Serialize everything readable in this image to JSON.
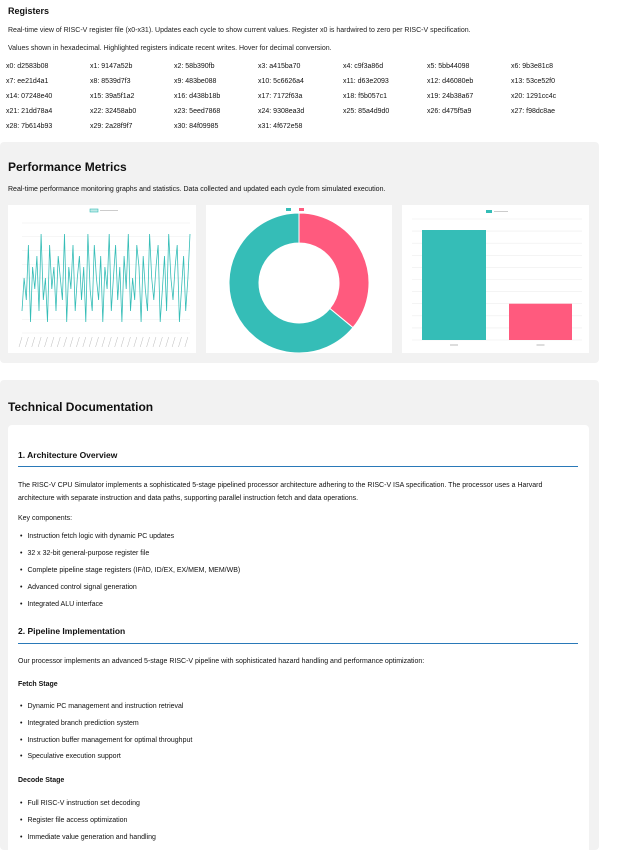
{
  "registers": {
    "title": "Registers",
    "desc1": "Real-time view of RISC-V register file (x0-x31). Updates each cycle to show current values. Register x0 is hardwired to zero per RISC-V specification.",
    "desc2": "Values shown in hexadecimal. Highlighted registers indicate recent writes. Hover for decimal conversion.",
    "items": [
      "x0: d2583b08",
      "x1: 9147a52b",
      "x2: 58b390fb",
      "x3: a415ba70",
      "x4: c9f3a86d",
      "x5: 5bb44098",
      "x6: 9b3e81c8",
      "x7: ee21d4a1",
      "x8: 8539d7f3",
      "x9: 483be088",
      "x10: 5c6626a4",
      "x11: d63e2093",
      "x12: d46080eb",
      "x13: 53ce52f0",
      "x14: 07248e40",
      "x15: 39a5f1a2",
      "x16: d438b18b",
      "x17: 7172f63a",
      "x18: f5b057c1",
      "x19: 24b38a67",
      "x20: 1291cc4c",
      "x21: 21dd78a4",
      "x22: 32458ab0",
      "x23: 5eed7868",
      "x24: 9308ea3d",
      "x25: 85a4d9d0",
      "x26: d475f5a9",
      "x27: f98dc8ae",
      "x28: 7b614b93",
      "x29: 2a28f9f7",
      "x30: 84f09985",
      "x31: 4f672e58"
    ]
  },
  "performance": {
    "title": "Performance Metrics",
    "desc": "Real-time performance monitoring graphs and statistics. Data collected and updated each cycle from simulated execution."
  },
  "chart_data": [
    {
      "type": "line",
      "values": [
        2,
        5,
        3,
        8,
        1,
        6,
        4,
        7,
        2,
        9,
        3,
        5,
        1,
        8,
        4,
        6,
        2,
        7,
        5,
        3,
        9,
        1,
        6,
        4,
        8,
        2,
        5,
        7,
        3,
        6,
        1,
        9,
        4,
        2,
        8,
        5,
        3,
        7,
        1,
        6,
        4,
        9,
        2,
        5,
        8,
        3,
        6,
        1,
        7,
        4,
        9,
        2,
        5,
        3,
        8,
        6,
        1,
        7,
        4,
        2,
        9,
        5,
        3,
        6,
        8,
        1,
        4,
        7,
        2,
        9,
        5,
        3,
        6,
        8,
        1,
        4,
        7,
        2,
        5,
        9
      ],
      "ylim": [
        0,
        10
      ]
    },
    {
      "type": "pie",
      "values": [
        36,
        64
      ],
      "colors": [
        "#ff5a7e",
        "#35bdb7"
      ]
    },
    {
      "type": "bar",
      "values": [
        1.0,
        0.33
      ],
      "colors": [
        "#35bdb7",
        "#ff5a7e"
      ],
      "ylim": [
        0,
        1.1
      ]
    }
  ],
  "docs": {
    "title": "Technical Documentation",
    "s1": {
      "heading": "1. Architecture Overview",
      "para": "The RISC-V CPU Simulator implements a sophisticated 5-stage pipelined processor architecture adhering to the RISC-V ISA specification. The processor uses a Harvard architecture with separate instruction and data paths, supporting parallel instruction fetch and data operations.",
      "key": "Key components:",
      "bullets": [
        "Instruction fetch logic with dynamic PC updates",
        "32 x 32-bit general-purpose register file",
        "Complete pipeline stage registers (IF/ID, ID/EX, EX/MEM, MEM/WB)",
        "Advanced control signal generation",
        "Integrated ALU interface"
      ]
    },
    "s2": {
      "heading": "2. Pipeline Implementation",
      "para": "Our processor implements an advanced 5-stage RISC-V pipeline with sophisticated hazard handling and performance optimization:",
      "fetch_title": "Fetch Stage",
      "fetch_bullets": [
        "Dynamic PC management and instruction retrieval",
        "Integrated branch prediction system",
        "Instruction buffer management for optimal throughput",
        "Speculative execution support"
      ],
      "decode_title": "Decode Stage",
      "decode_bullets": [
        "Full RISC-V instruction set decoding",
        "Register file access optimization",
        "Immediate value generation and handling"
      ]
    }
  }
}
